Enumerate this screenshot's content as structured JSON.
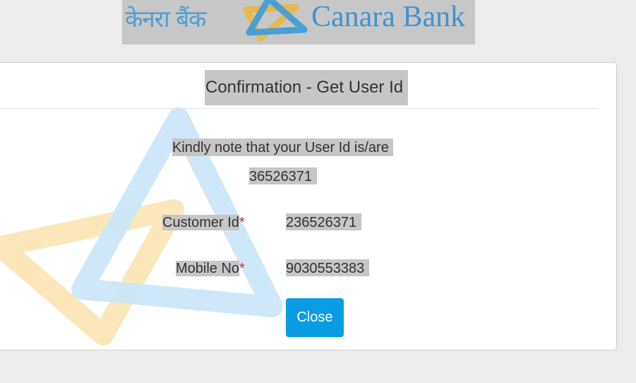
{
  "header": {
    "logo_hindi": "केनरा बैंक",
    "logo_english": "Canara Bank",
    "logo_icon": "canara-bank-triangle-logo"
  },
  "modal": {
    "title": "Confirmation - Get User Id",
    "note": "Kindly note that your User Id is/are",
    "user_id": "36526371",
    "fields": [
      {
        "label": "Customer Id",
        "required_mark": "*",
        "value": "236526371"
      },
      {
        "label": "Mobile No",
        "required_mark": "*",
        "value": "9030553383"
      }
    ],
    "close_label": "Close"
  },
  "colors": {
    "page_background": "#ececec",
    "highlight": "#c6c6c6",
    "button": "#0a9be5",
    "required": "#e02020",
    "brand_blue": "#3f93cf",
    "brand_yellow": "#f2b13a"
  }
}
